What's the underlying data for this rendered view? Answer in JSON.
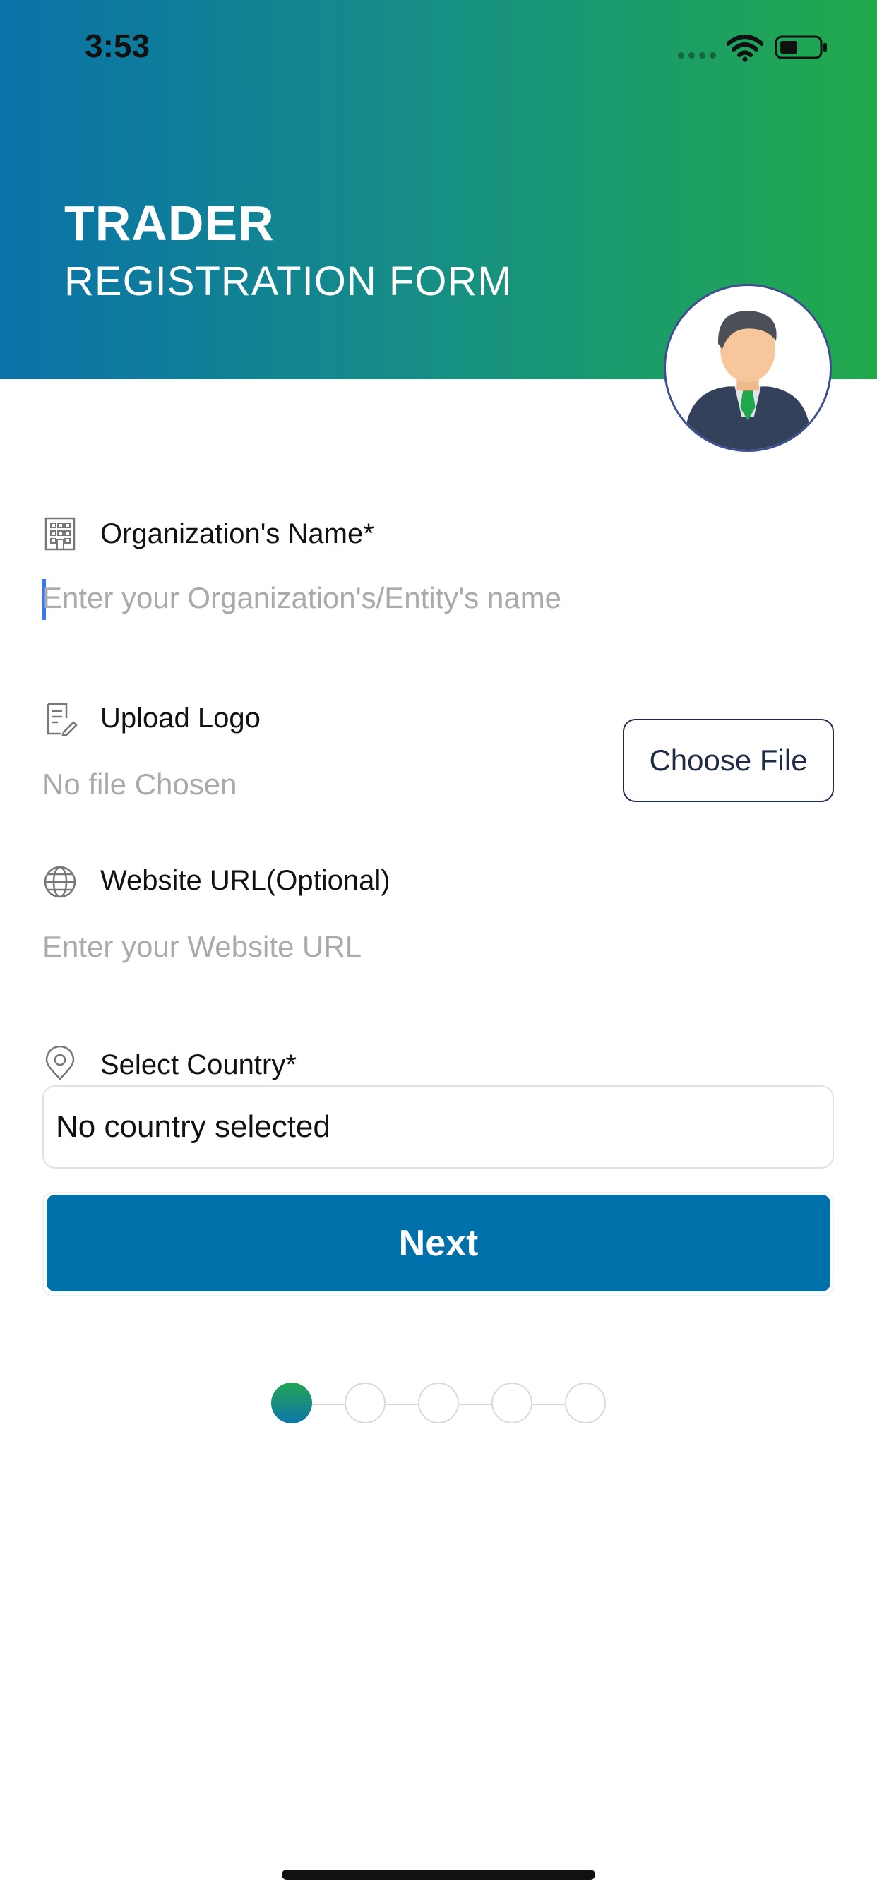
{
  "status_bar": {
    "time": "3:53",
    "icons": [
      "cellular-dots-icon",
      "wifi-icon",
      "battery-icon"
    ]
  },
  "header": {
    "title": "TRADER",
    "subtitle": "REGISTRATION FORM",
    "gradient_colors": [
      "#0a72a9",
      "#22a94b"
    ],
    "avatar_icon": "businessman-avatar-icon"
  },
  "form": {
    "organization": {
      "icon": "building-icon",
      "label": "Organization's Name*",
      "placeholder": "Enter your Organization's/Entity's name",
      "value": ""
    },
    "logo": {
      "icon": "document-edit-icon",
      "label": "Upload Logo",
      "status": "No file Chosen",
      "button_label": "Choose File"
    },
    "website": {
      "icon": "globe-icon",
      "label": "Website URL(Optional)",
      "placeholder": "Enter your Website URL",
      "value": ""
    },
    "country": {
      "icon": "location-pin-icon",
      "label": "Select Country*",
      "selected": "No country selected"
    }
  },
  "actions": {
    "next_label": "Next",
    "primary_color": "#0070aa"
  },
  "stepper": {
    "total_steps": 5,
    "current_step": 1
  }
}
